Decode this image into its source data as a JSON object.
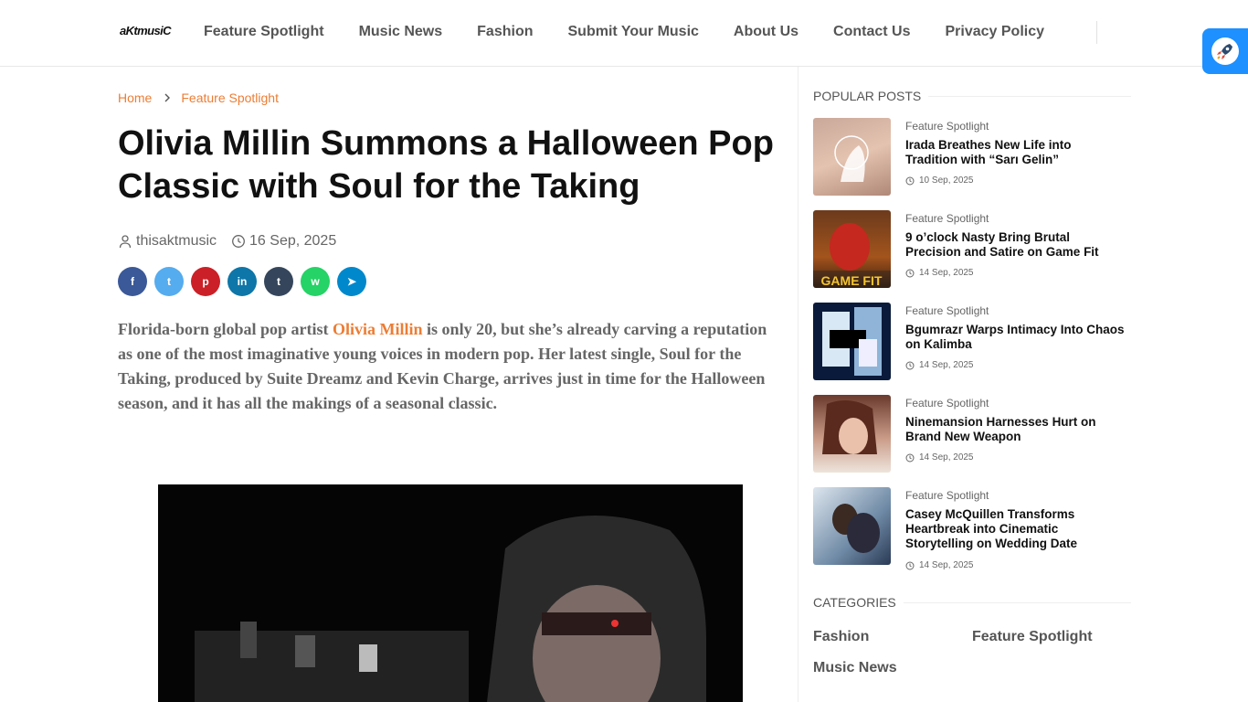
{
  "site": {
    "logo_text": "aKtmusiC",
    "logo_sub": "..."
  },
  "nav": {
    "items": [
      "Feature Spotlight",
      "Music News",
      "Fashion",
      "Submit Your Music",
      "About Us",
      "Contact Us",
      "Privacy Policy"
    ]
  },
  "breadcrumb": {
    "home": "Home",
    "current": "Feature Spotlight"
  },
  "article": {
    "title": "Olivia Millin Summons a Halloween Pop Classic with Soul for the Taking",
    "author": "thisaktmusic",
    "date": "16 Sep, 2025",
    "lead_before": "Florida-born global pop artist ",
    "lead_link": "Olivia Millin",
    "lead_after": " is only 20, but she’s already carving a reputation as one of the most imaginative young voices in modern pop. Her latest single, Soul for the Taking, produced by Suite Dreamz and Kevin Charge, arrives just in time for the Halloween season, and it has all the makings of a seasonal classic."
  },
  "share": [
    {
      "name": "facebook",
      "glyph": "f",
      "color": "#3b5998"
    },
    {
      "name": "twitter",
      "glyph": "t",
      "color": "#55acee"
    },
    {
      "name": "pinterest",
      "glyph": "p",
      "color": "#cb2027"
    },
    {
      "name": "linkedin",
      "glyph": "in",
      "color": "#0e76a8"
    },
    {
      "name": "tumblr",
      "glyph": "t",
      "color": "#35465c"
    },
    {
      "name": "whatsapp",
      "glyph": "w",
      "color": "#25d366"
    },
    {
      "name": "telegram",
      "glyph": "➤",
      "color": "#0088cc"
    }
  ],
  "sidebar": {
    "popular_title": "POPULAR POSTS",
    "posts": [
      {
        "category": "Feature Spotlight",
        "title": "Irada Breathes New Life into Tradition with “Sarı Gelin”",
        "date": "10 Sep, 2025"
      },
      {
        "category": "Feature Spotlight",
        "title": "9 o’clock Nasty Bring Brutal Precision and Satire on Game Fit",
        "date": "14 Sep, 2025",
        "thumb_text": "GAME FIT"
      },
      {
        "category": "Feature Spotlight",
        "title": "Bgumrazr Warps Intimacy Into Chaos on Kalimba",
        "date": "14 Sep, 2025"
      },
      {
        "category": "Feature Spotlight",
        "title": "Ninemansion Harnesses Hurt on Brand New Weapon",
        "date": "14 Sep, 2025"
      },
      {
        "category": "Feature Spotlight",
        "title": "Casey McQuillen Transforms Heartbreak into Cinematic Storytelling on Wedding Date",
        "date": "14 Sep, 2025"
      }
    ],
    "categories_title": "CATEGORIES",
    "categories": [
      "Fashion",
      "Feature Spotlight",
      "Music News"
    ]
  },
  "colors": {
    "accent": "#ec7d34",
    "rocket": "#1e90ff"
  }
}
